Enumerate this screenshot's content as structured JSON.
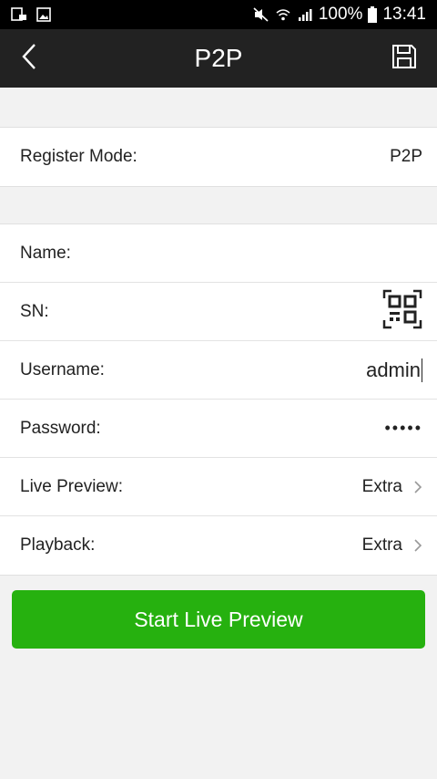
{
  "status_bar": {
    "battery": "100%",
    "time": "13:41"
  },
  "header": {
    "title": "P2P"
  },
  "register": {
    "label": "Register Mode:",
    "value": "P2P"
  },
  "form": {
    "name_label": "Name:",
    "name_value": "",
    "sn_label": "SN:",
    "sn_value": "",
    "username_label": "Username:",
    "username_value": "admin",
    "password_label": "Password:",
    "password_value": "•••••",
    "live_preview_label": "Live Preview:",
    "live_preview_value": "Extra",
    "playback_label": "Playback:",
    "playback_value": "Extra"
  },
  "actions": {
    "start_live_preview": "Start Live Preview"
  },
  "colors": {
    "accent": "#26b10f",
    "header_bg": "#222222"
  },
  "icons": {
    "back": "chevron-left-icon",
    "save": "floppy-disk-icon",
    "qr": "qr-code-icon",
    "chevron_right": "chevron-right-icon"
  }
}
